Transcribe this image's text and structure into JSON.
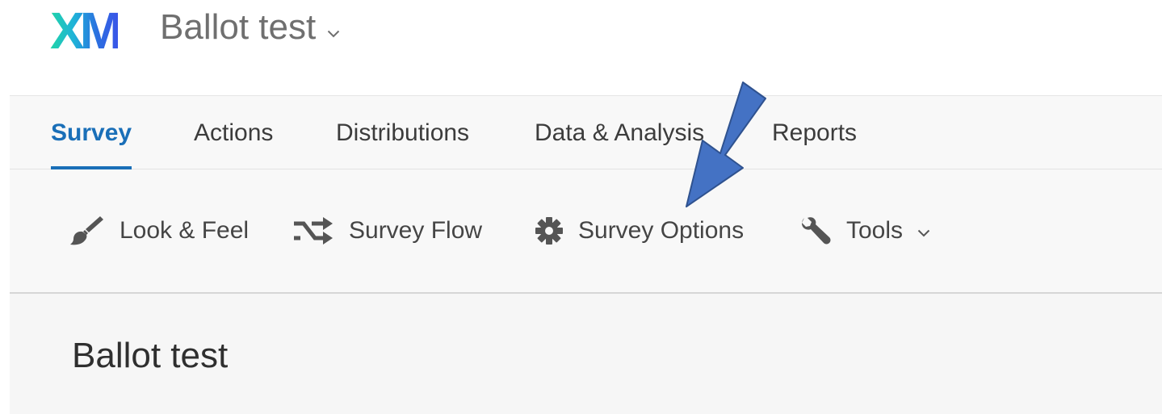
{
  "header": {
    "logo_text": "XM",
    "project_title": "Ballot test",
    "dropdown_icon": "chevron-down-icon"
  },
  "tabs": [
    {
      "label": "Survey",
      "active": true
    },
    {
      "label": "Actions",
      "active": false
    },
    {
      "label": "Distributions",
      "active": false
    },
    {
      "label": "Data & Analysis",
      "active": false
    },
    {
      "label": "Reports",
      "active": false
    }
  ],
  "toolbar": {
    "items": [
      {
        "label": "Look & Feel",
        "icon": "paintbrush-icon"
      },
      {
        "label": "Survey Flow",
        "icon": "shuffle-icon"
      },
      {
        "label": "Survey Options",
        "icon": "gear-icon"
      },
      {
        "label": "Tools",
        "icon": "wrench-icon",
        "has_dropdown": true
      }
    ]
  },
  "content": {
    "survey_title": "Ballot test"
  },
  "colors": {
    "accent": "#1a6fb8",
    "annotation_arrow": "#4472c4"
  }
}
